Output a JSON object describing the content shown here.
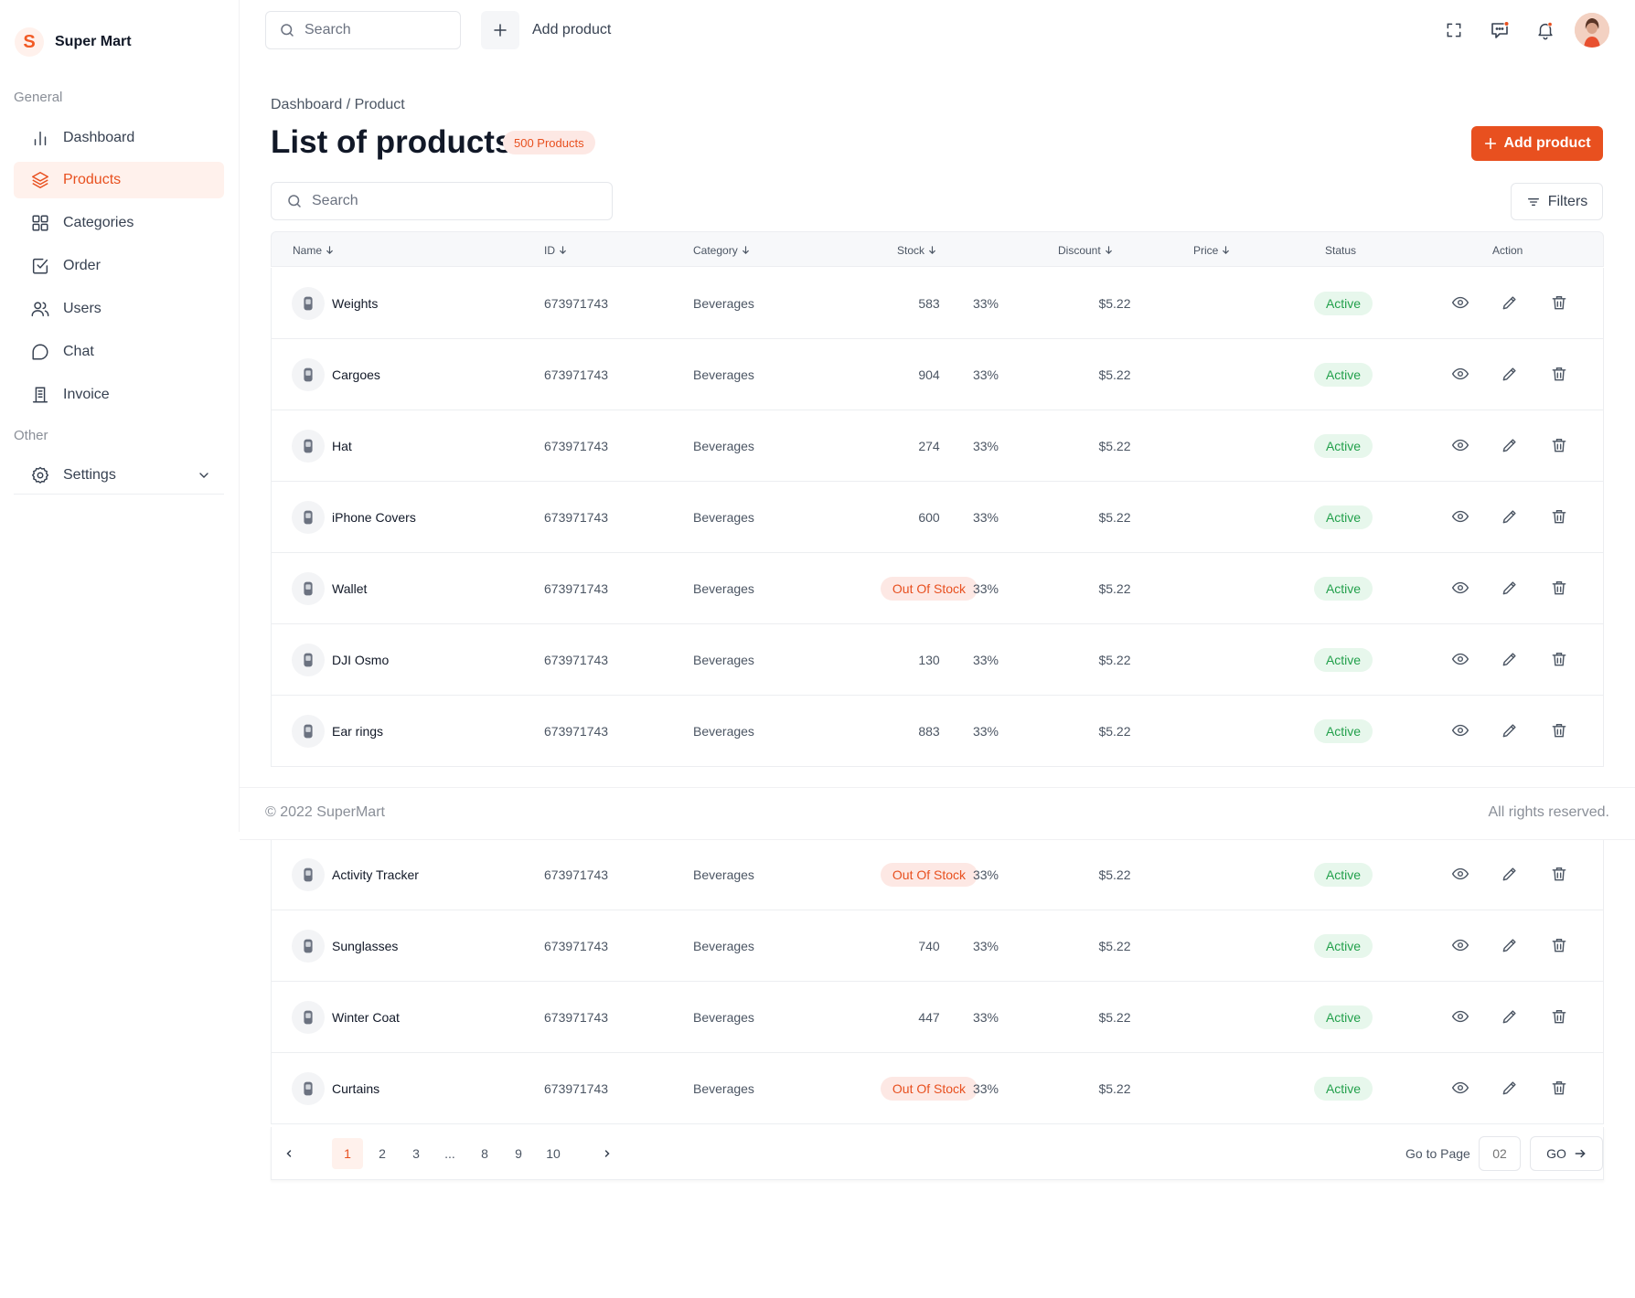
{
  "brand": {
    "logo_letter": "S",
    "name": "Super Mart",
    "accent": "#e8501f"
  },
  "sidebar": {
    "general_label": "General",
    "other_label": "Other",
    "items": [
      {
        "label": "Dashboard",
        "icon": "bar-chart-icon"
      },
      {
        "label": "Products",
        "icon": "layers-icon",
        "active": true
      },
      {
        "label": "Categories",
        "icon": "grid-icon"
      },
      {
        "label": "Order",
        "icon": "checkbox-icon"
      },
      {
        "label": "Users",
        "icon": "users-icon"
      },
      {
        "label": "Chat",
        "icon": "chat-icon"
      },
      {
        "label": "Invoice",
        "icon": "invoice-icon"
      }
    ],
    "settings_label": "Settings"
  },
  "topbar": {
    "search_placeholder": "Search",
    "add_product_label": "Add product"
  },
  "page": {
    "breadcrumb": "Dashboard / Product",
    "title": "List of products",
    "count_badge": "500 Products",
    "add_button_label": "Add product",
    "search_placeholder": "Search",
    "filters_label": "Filters"
  },
  "table": {
    "columns": {
      "name": "Name",
      "id": "ID",
      "category": "Category",
      "stock": "Stock",
      "discount": "Discount",
      "price": "Price",
      "status": "Status",
      "action": "Action"
    },
    "rows": [
      {
        "name": "Weights",
        "id": "673971743",
        "category": "Beverages",
        "stock": "583",
        "out_of_stock": false,
        "discount": "33%",
        "price": "$5.22",
        "status": "Active"
      },
      {
        "name": "Cargoes",
        "id": "673971743",
        "category": "Beverages",
        "stock": "904",
        "out_of_stock": false,
        "discount": "33%",
        "price": "$5.22",
        "status": "Active"
      },
      {
        "name": "Hat",
        "id": "673971743",
        "category": "Beverages",
        "stock": "274",
        "out_of_stock": false,
        "discount": "33%",
        "price": "$5.22",
        "status": "Active"
      },
      {
        "name": "iPhone Covers",
        "id": "673971743",
        "category": "Beverages",
        "stock": "600",
        "out_of_stock": false,
        "discount": "33%",
        "price": "$5.22",
        "status": "Active"
      },
      {
        "name": "Wallet",
        "id": "673971743",
        "category": "Beverages",
        "stock": "Out Of Stock",
        "out_of_stock": true,
        "discount": "33%",
        "price": "$5.22",
        "status": "Active"
      },
      {
        "name": "DJI Osmo",
        "id": "673971743",
        "category": "Beverages",
        "stock": "130",
        "out_of_stock": false,
        "discount": "33%",
        "price": "$5.22",
        "status": "Active"
      },
      {
        "name": "Ear rings",
        "id": "673971743",
        "category": "Beverages",
        "stock": "883",
        "out_of_stock": false,
        "discount": "33%",
        "price": "$5.22",
        "status": "Active"
      },
      {
        "name": "Activity Tracker",
        "id": "673971743",
        "category": "Beverages",
        "stock": "Out Of Stock",
        "out_of_stock": true,
        "discount": "33%",
        "price": "$5.22",
        "status": "Active"
      },
      {
        "name": "Sunglasses",
        "id": "673971743",
        "category": "Beverages",
        "stock": "740",
        "out_of_stock": false,
        "discount": "33%",
        "price": "$5.22",
        "status": "Active"
      },
      {
        "name": "Winter Coat",
        "id": "673971743",
        "category": "Beverages",
        "stock": "447",
        "out_of_stock": false,
        "discount": "33%",
        "price": "$5.22",
        "status": "Active"
      },
      {
        "name": "Curtains",
        "id": "673971743",
        "category": "Beverages",
        "stock": "Out Of Stock",
        "out_of_stock": true,
        "discount": "33%",
        "price": "$5.22",
        "status": "Active"
      }
    ]
  },
  "footer": {
    "copyright": "© 2022 SuperMart",
    "rights": "All rights reserved."
  },
  "pagination": {
    "pages": [
      "1",
      "2",
      "3",
      "...",
      "8",
      "9",
      "10"
    ],
    "current": "1",
    "goto_label": "Go to Page",
    "goto_placeholder": "02",
    "go_label": "GO"
  }
}
